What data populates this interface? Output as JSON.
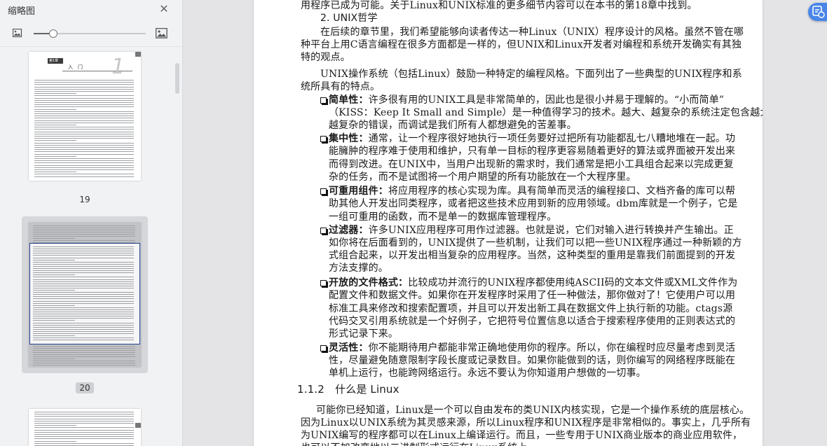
{
  "sidebar": {
    "title": "缩略图",
    "thumbnails": [
      {
        "page_number": "19",
        "chapter_tag": "第1章",
        "chapter_title": "入　门",
        "big_numeral": "1"
      },
      {
        "page_number": "20"
      },
      {
        "page_number": ""
      }
    ],
    "active_page": "20",
    "zoom_level": 0.17
  },
  "document": {
    "lines": [
      {
        "t": "用程序已成为可能。关于Linux和UNIX标准的更多细节内容可以在本书的第18章中找到。"
      },
      {
        "t": "2. UNIX哲学"
      },
      {
        "t": "在后续的章节里，我们希望能够向读者传达一种Linux（UNIX）程序设计的风格。虽然不管在哪"
      },
      {
        "t": "种平台上用C语言编程在很多方面都是一样的，但UNIX和Linux开发者对编程和系统开发确实有其独"
      },
      {
        "t": "特的观点。"
      },
      {
        "t": "UNIX操作系统（包括Linux）鼓励一种特定的编程风格。下面列出了一些典型的UNIX程序和系"
      },
      {
        "t": "统所具有的特点。"
      },
      {
        "k": "简单性：",
        "t": "许多很有用的UNIX工具是非常简单的，因此也是很小并易于理解的。“小而简单”"
      },
      {
        "t": "（KISS：Keep It Small and Simple）是一种值得学习的技术。越大、越复杂的系统注定包含越大、"
      },
      {
        "t": "越复杂的错误，而调试是我们所有人都想避免的苦差事。"
      },
      {
        "k": "集中性：",
        "t": "通常，让一个程序很好地执行一项任务要好过把所有功能都乱七八糟地堆在一起。功"
      },
      {
        "t": "能臃肿的程序难于使用和维护，只有单一目标的程序更容易随着更好的算法或界面被开发出来"
      },
      {
        "t": "而得到改进。在UNIX中，当用户出现新的需求时，我们通常是把小工具组合起来以完成更复"
      },
      {
        "t": "杂的任务，而不是试图将一个用户期望的所有功能放在一个大程序里。"
      },
      {
        "k": "可重用组件：",
        "t": "将应用程序的核心实现为库。具有简单而灵活的编程接口、文档齐备的库可以帮"
      },
      {
        "t": "助其他人开发出同类程序，或者把这些技术应用到新的应用领域。dbm库就是一个例子，它是"
      },
      {
        "t": "一组可重用的函数，而不是单一的数据库管理程序。"
      },
      {
        "k": "过滤器：",
        "t": "许多UNIX应用程序可用作过滤器。也就是说，它们对输入进行转换并产生输出。正"
      },
      {
        "t": "如你将在后面看到的，UNIX提供了一些机制，让我们可以把一些UNIX程序通过一种新颖的方"
      },
      {
        "t": "式组合起来，以开发出相当复杂的应用程序。当然，这种类型的重用是靠我们前面提到的开发"
      },
      {
        "t": "方法支撑的。"
      },
      {
        "k": "开放的文件格式：",
        "t": "比较成功并流行的UNIX程序都使用纯ASCII码的文本文件或XML文件作为"
      },
      {
        "t": "配置文件和数据文件。如果你在开发程序时采用了任一种做法，那你做对了！它使用户可以用"
      },
      {
        "t": "标准工具来修改和搜索配置项，并且可以开发出新工具在数据文件上执行新的功能。ctags源"
      },
      {
        "t": "代码交叉引用系统就是一个好例子，它把符号位置信息以适合于搜索程序使用的正则表达式的"
      },
      {
        "t": "形式记录下来。"
      },
      {
        "k": "灵活性：",
        "t": "你不能期待用户都能非常正确地使用你的程序。所以，你在编程时应尽量考虑到灵活"
      },
      {
        "t": "性，尽量避免随意限制字段长度或记录数目。如果你能做到的话，则你编写的网络程序既能在"
      },
      {
        "t": "单机上运行，也能跨网络运行。永远不要认为你知道用户想做的一切事。"
      },
      {
        "t": "1.1.2　什么是 Linux"
      },
      {
        "t": "可能你已经知道，Linux是一个可以自由发布的类UNIX内核实现，它是一个操作系统的底层核心。"
      },
      {
        "t": "因为Linux以UNIX系统为其灵感来源，所以Linux程序和UNIX程序是非常相似的。事实上，几乎所有"
      },
      {
        "t": "为UNIX编写的程序都可以在Linux上编译运行。而且，一些专用于UNIX商业版本的商业应用软件，"
      },
      {
        "t": "也可以不加改变地以二进制形式运行在Linux系统上。"
      }
    ]
  },
  "colors": {
    "accent": "#4a86e8",
    "panel_bg": "#f1f2f4",
    "viewer_bg": "#e4e4e6"
  },
  "icons": {
    "close": "close-icon",
    "zoom_out": "image-small-icon",
    "zoom_in": "image-large-icon",
    "float": "translate-icon"
  }
}
